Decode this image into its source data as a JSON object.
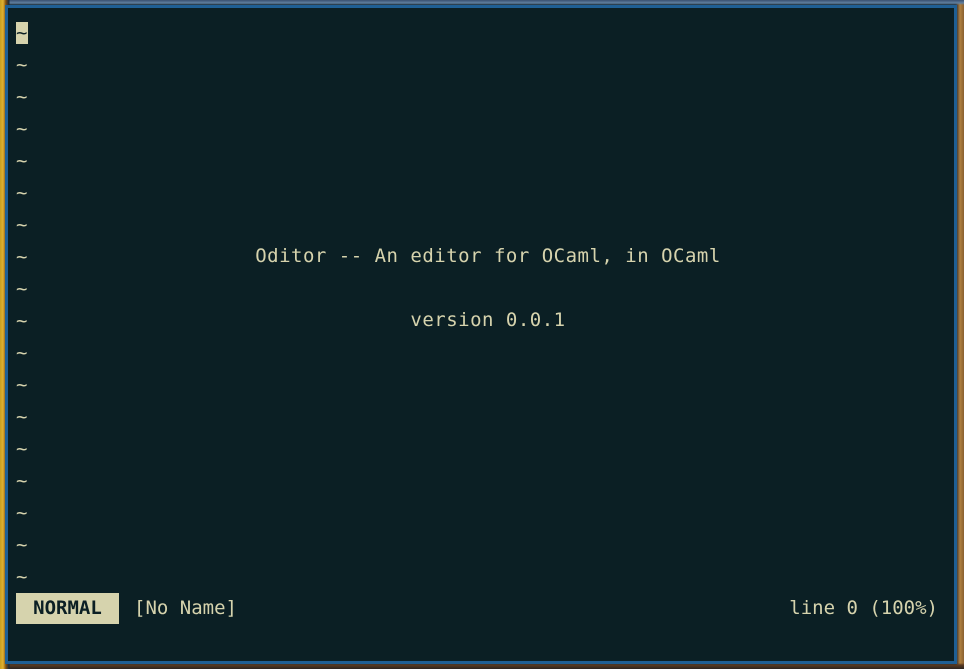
{
  "editor": {
    "tilde_glyph": "~",
    "tilde_count": 18,
    "splash": {
      "title": "Oditor -- An editor for OCaml, in OCaml",
      "version": "version 0.0.1"
    }
  },
  "statusline": {
    "mode": "NORMAL",
    "filename": "[No Name]",
    "position": "line 0 (100%)"
  },
  "colors": {
    "background": "#0b1f24",
    "foreground": "#d6d3ad",
    "window_border": "#1f5f94"
  }
}
